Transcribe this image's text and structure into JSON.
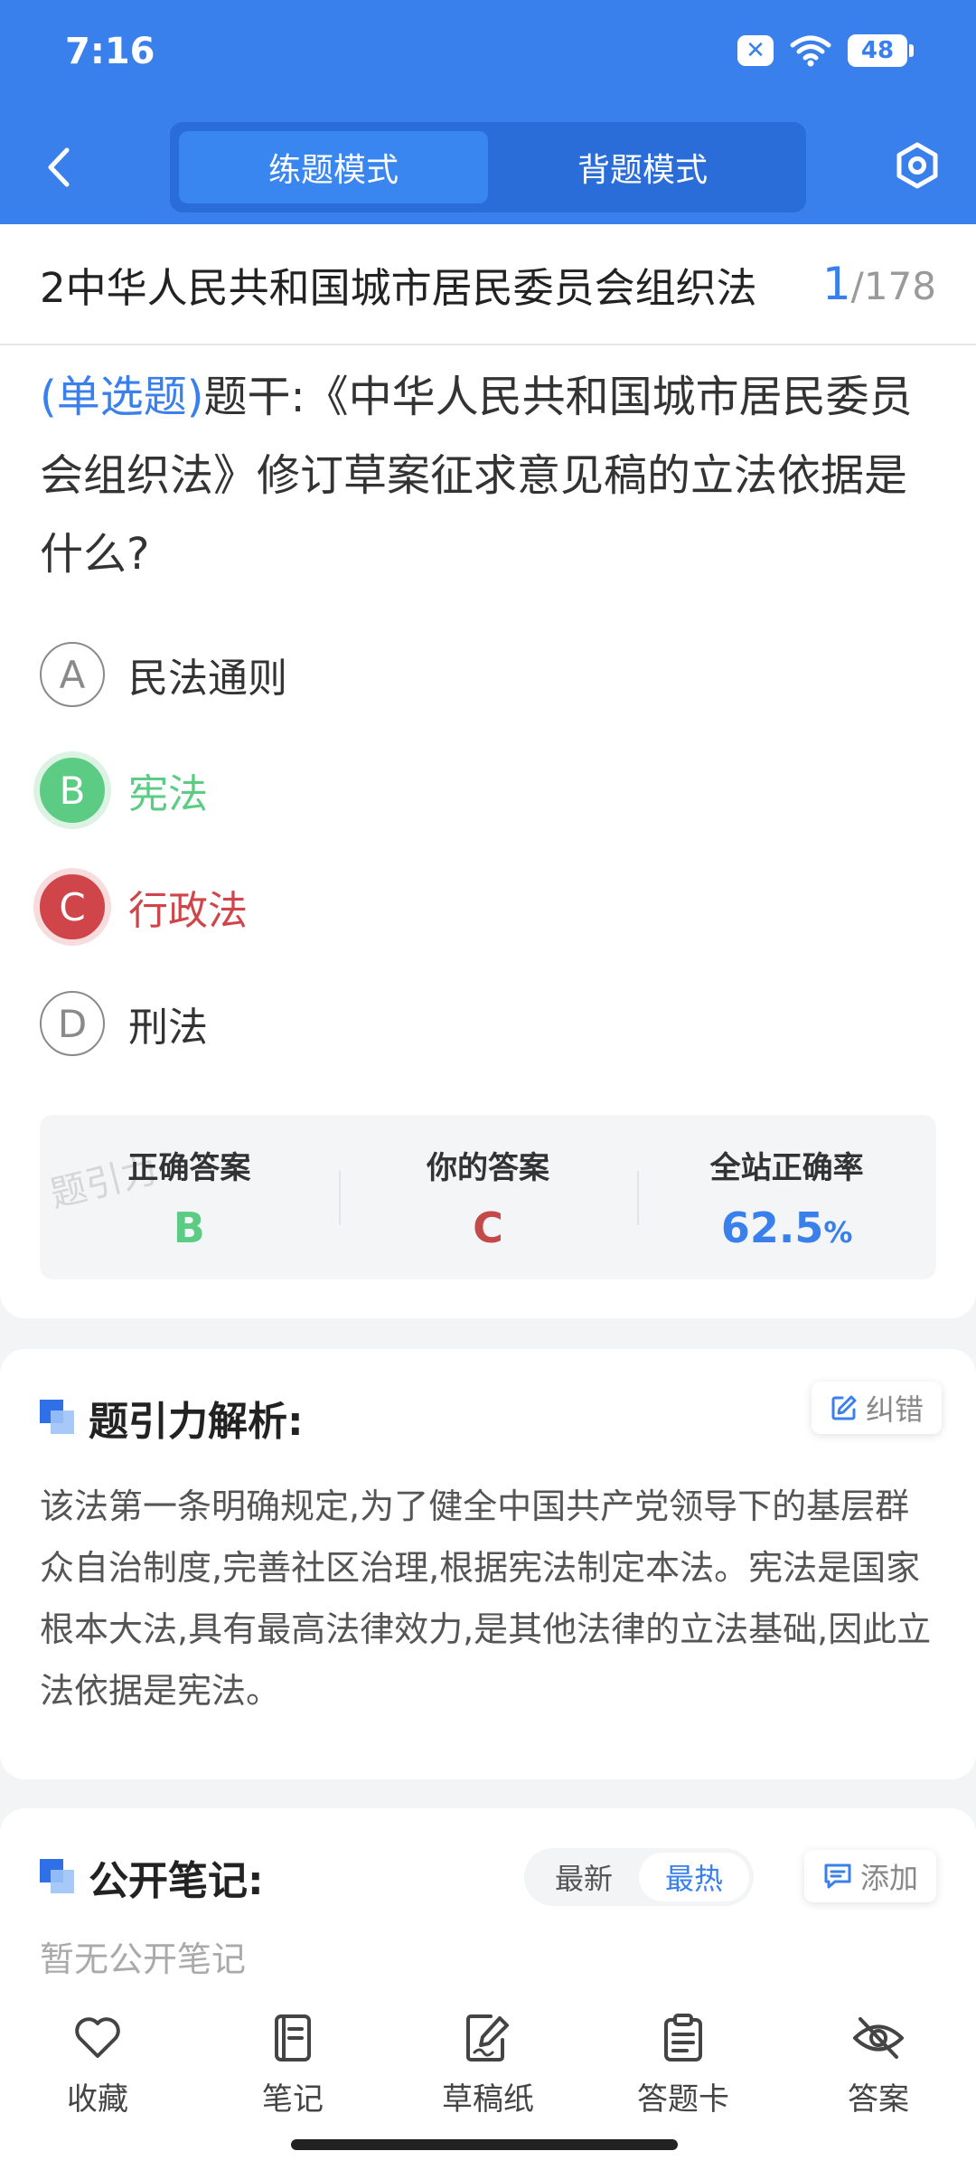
{
  "status": {
    "time": "7:16",
    "battery": "48"
  },
  "header": {
    "tabs": [
      {
        "label": "练题模式",
        "active": true
      },
      {
        "label": "背题模式",
        "active": false
      }
    ]
  },
  "question": {
    "category": "2中华人民共和国城市居民委员会组织法",
    "index": "1",
    "total": "/178",
    "type": "(单选题)",
    "stem": "题干:《中华人民共和国城市居民委员会组织法》修订草案征求意见稿的立法依据是什么?",
    "options": [
      {
        "letter": "A",
        "text": "民法通则",
        "state": "normal"
      },
      {
        "letter": "B",
        "text": "宪法",
        "state": "correct"
      },
      {
        "letter": "C",
        "text": "行政法",
        "state": "wrong"
      },
      {
        "letter": "D",
        "text": "刑法",
        "state": "normal"
      }
    ]
  },
  "stats": {
    "correct_label": "正确答案",
    "correct_value": "B",
    "yours_label": "你的答案",
    "yours_value": "C",
    "rate_label": "全站正确率",
    "rate_value": "62.5",
    "rate_unit": "%",
    "watermark": "题引力"
  },
  "analysis": {
    "title": "题引力解析:",
    "report_label": "纠错",
    "text": "该法第一条明确规定,为了健全中国共产党领导下的基层群众自治制度,完善社区治理,根据宪法制定本法。宪法是国家根本大法,具有最高法律效力,是其他法律的立法基础,因此立法依据是宪法。"
  },
  "notes": {
    "title": "公开笔记:",
    "sort_latest": "最新",
    "sort_hot": "最热",
    "add_label": "添加",
    "empty": "暂无公开笔记"
  },
  "bottom_bar": [
    {
      "label": "收藏",
      "icon": "heart-icon"
    },
    {
      "label": "笔记",
      "icon": "notebook-icon"
    },
    {
      "label": "草稿纸",
      "icon": "draft-icon"
    },
    {
      "label": "答题卡",
      "icon": "answer-card-icon"
    },
    {
      "label": "答案",
      "icon": "eye-off-icon"
    }
  ],
  "colors": {
    "primary": "#3a80ec",
    "correct": "#5ccc85",
    "wrong": "#d0454a"
  }
}
